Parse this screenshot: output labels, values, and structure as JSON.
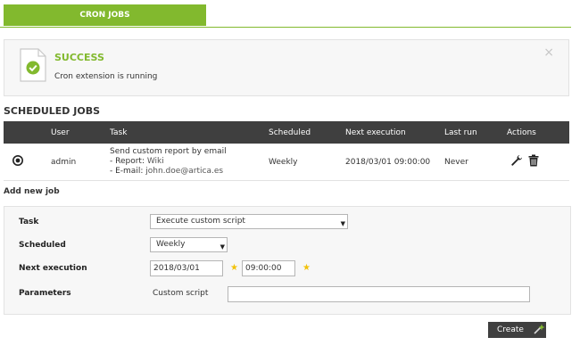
{
  "tabs": [
    {
      "label": "CRON JOBS"
    }
  ],
  "alert": {
    "title": "SUCCESS",
    "message": "Cron extension is running",
    "close": "×"
  },
  "section_title": "SCHEDULED JOBS",
  "jobs_table": {
    "columns": [
      "",
      "User",
      "Task",
      "Scheduled",
      "Next execution",
      "Last run",
      "Actions"
    ],
    "rows": [
      {
        "user": "admin",
        "task_title": "Send custom report by email",
        "task_report_label": "- Report:",
        "task_report_value": "Wiki",
        "task_email_label": "- E-mail:",
        "task_email_value": "john.doe@artica.es",
        "scheduled": "Weekly",
        "next_execution": "2018/03/01 09:00:00",
        "last_run": "Never"
      }
    ]
  },
  "add_job": {
    "title": "Add new job",
    "labels": {
      "task": "Task",
      "scheduled": "Scheduled",
      "next_execution": "Next execution",
      "parameters": "Parameters"
    },
    "task_value": "Execute custom script",
    "scheduled_value": "Weekly",
    "date_value": "2018/03/01",
    "time_value": "09:00:00",
    "parameter_label": "Custom script",
    "parameter_value": ""
  },
  "create_button": "Create",
  "colors": {
    "accent": "#82b92e",
    "header_dark": "#3f3f3f",
    "star": "#f2c20a"
  }
}
